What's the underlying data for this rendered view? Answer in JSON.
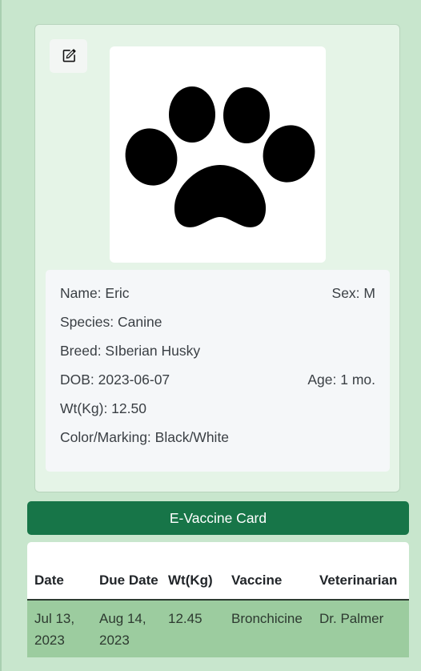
{
  "profile": {
    "edit_icon": "edit-icon",
    "photo_icon": "paw-print-icon",
    "name": "Name: Eric",
    "sex": "Sex: M",
    "species": "Species: Canine",
    "breed": "Breed: SIberian Husky",
    "dob": "DOB: 2023-06-07",
    "age": "Age: 1 mo.",
    "weight": "Wt(Kg): 12.50",
    "color_marking": "Color/Marking: Black/White"
  },
  "vaccine_card": {
    "title": "E-Vaccine Card",
    "columns": [
      "Date",
      "Due Date",
      "Wt(Kg)",
      "Vaccine",
      "Veterinarian"
    ],
    "rows": [
      {
        "date": "Jul 13, 2023",
        "due_date": "Aug 14, 2023",
        "weight": "12.45",
        "vaccine": "Bronchicine",
        "veterinarian": "Dr. Palmer"
      }
    ]
  },
  "colors": {
    "page_background": "#c8e6cd",
    "card_background": "#e5f4e7",
    "banner_green": "#177548",
    "row_green": "#9ccc9f"
  }
}
